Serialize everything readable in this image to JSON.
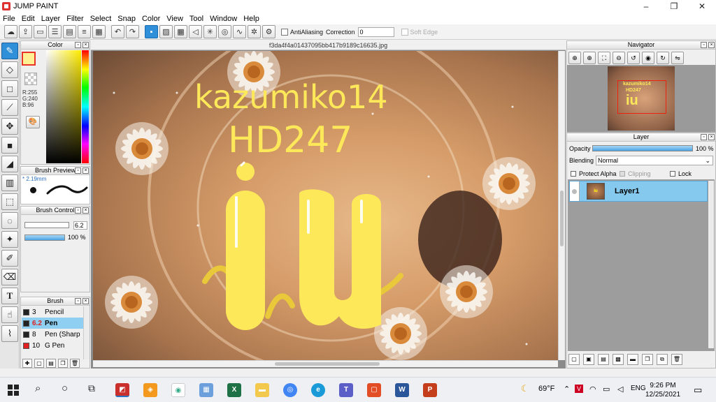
{
  "window": {
    "title": "JUMP PAINT",
    "controls": [
      "–",
      "❐",
      "✕"
    ]
  },
  "menu": [
    "File",
    "Edit",
    "Layer",
    "Filter",
    "Select",
    "Snap",
    "Color",
    "View",
    "Tool",
    "Window",
    "Help"
  ],
  "toolbar": {
    "antialiasing_label": "AntiAliasing",
    "correction_label": "Correction",
    "correction_value": "0",
    "soft_edge_label": "Soft Edge"
  },
  "document": {
    "filename": "f3da4f4a01437095bb417b9189c16635.jpg"
  },
  "canvas_drawing": {
    "line1": "kazumiko14",
    "line2": "HD247",
    "big": "iu"
  },
  "color_panel": {
    "title": "Color",
    "r": "R:255",
    "g": "G:240",
    "b": "B:96",
    "foreground": "#fff094"
  },
  "brush_preview": {
    "title": "Brush Preview",
    "size": "* 2.19mm"
  },
  "brush_control": {
    "title": "Brush Control",
    "size_value": "6.2",
    "size_fraction": 0.85,
    "opacity_value": "100 %",
    "opacity_fraction": 1.0
  },
  "brush": {
    "title": "Brush",
    "items": [
      {
        "size": "3",
        "name": "Pencil",
        "color": "#222222"
      },
      {
        "size": "6.2",
        "name": "Pen",
        "color": "#222222"
      },
      {
        "size": "8",
        "name": "Pen (Sharp",
        "color": "#222222"
      },
      {
        "size": "10",
        "name": "G Pen",
        "color": "#e02020"
      }
    ]
  },
  "navigator": {
    "title": "Navigator"
  },
  "layer": {
    "title": "Layer",
    "opacity_label": "Opacity",
    "opacity_value": "100 %",
    "opacity_fraction": 1.0,
    "blending_label": "Blending",
    "blending_value": "Normal",
    "protect_alpha": "Protect Alpha",
    "clipping": "Clipping",
    "lock": "Lock",
    "layers": [
      {
        "name": "Layer1",
        "thumb_text": "iu"
      }
    ]
  },
  "taskbar": {
    "weather": "69°F",
    "lang": "ENG",
    "time": "9:26 PM",
    "date": "12/25/2021",
    "excel": "X",
    "word": "W",
    "ppt": "P"
  }
}
